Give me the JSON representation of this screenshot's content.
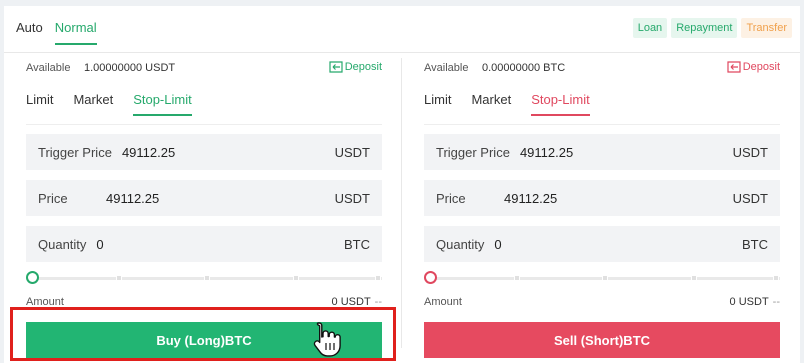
{
  "mode_tabs": [
    {
      "label": "Auto",
      "active": false
    },
    {
      "label": "Normal",
      "active": true
    }
  ],
  "top_actions": {
    "loan": "Loan",
    "repayment": "Repayment",
    "transfer": "Transfer"
  },
  "buy": {
    "available_label": "Available",
    "available_value": "1.00000000 USDT",
    "deposit_label": "Deposit",
    "order_tabs": [
      "Limit",
      "Market",
      "Stop-Limit"
    ],
    "active_tab": "Stop-Limit",
    "trigger_label": "Trigger Price",
    "trigger_value": "49112.25",
    "trigger_unit": "USDT",
    "price_label": "Price",
    "price_value": "49112.25",
    "price_unit": "USDT",
    "quantity_label": "Quantity",
    "quantity_value": "0",
    "quantity_unit": "BTC",
    "slider_percent": 0,
    "amount_label": "Amount",
    "amount_value": "0 USDT",
    "amount_suffix": "--",
    "button_label": "Buy (Long)BTC"
  },
  "sell": {
    "available_label": "Available",
    "available_value": "0.00000000 BTC",
    "deposit_label": "Deposit",
    "order_tabs": [
      "Limit",
      "Market",
      "Stop-Limit"
    ],
    "active_tab": "Stop-Limit",
    "trigger_label": "Trigger Price",
    "trigger_value": "49112.25",
    "trigger_unit": "USDT",
    "price_label": "Price",
    "price_value": "49112.25",
    "price_unit": "USDT",
    "quantity_label": "Quantity",
    "quantity_value": "0",
    "quantity_unit": "BTC",
    "slider_percent": 0,
    "amount_label": "Amount",
    "amount_value": "0 USDT",
    "amount_suffix": "--",
    "button_label": "Sell (Short)BTC"
  },
  "colors": {
    "buy_accent": "#26a96c",
    "buy_button": "#22b573",
    "sell_accent": "#e0485f",
    "sell_button": "#e64a60",
    "highlight": "#e0201c"
  },
  "icons": {
    "deposit": "deposit-icon",
    "cursor": "hand-pointer-icon"
  }
}
